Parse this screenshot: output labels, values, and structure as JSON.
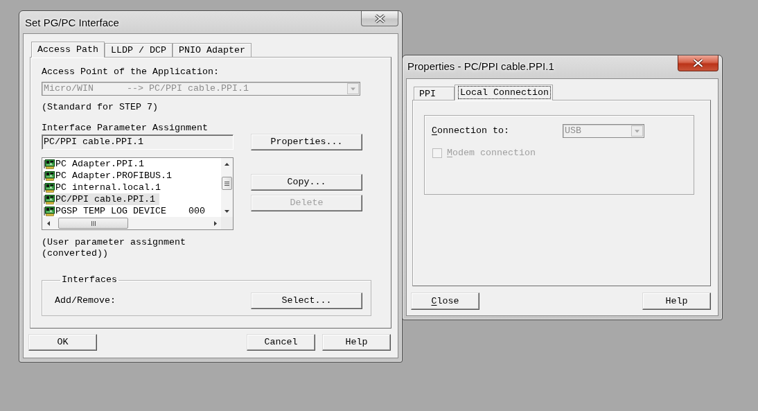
{
  "main_dialog": {
    "title": "Set PG/PC Interface",
    "active": false,
    "tabs": [
      {
        "label": "Access Path",
        "selected": true
      },
      {
        "label": "LLDP / DCP",
        "selected": false
      },
      {
        "label": "PNIO Adapter",
        "selected": false
      }
    ],
    "access_point": {
      "label": "Access Point of the Application:",
      "value": "Micro/WIN      --> PC/PPI cable.PPI.1",
      "disabled": true,
      "note": "(Standard for STEP 7)"
    },
    "parameter_assignment": {
      "label": "Interface Parameter Assignment",
      "value": "PC/PPI cable.PPI.1",
      "read_only": true,
      "items": [
        {
          "label": "PC Adapter.PPI.1",
          "selected": false
        },
        {
          "label": "PC Adapter.PROFIBUS.1",
          "selected": false
        },
        {
          "label": "PC internal.local.1",
          "selected": false
        },
        {
          "label": "PC/PPI cable.PPI.1",
          "selected": true
        },
        {
          "label": "PGSP TEMP LOG DEVICE    000",
          "selected": false
        }
      ],
      "note": "(User parameter assignment (converted))"
    },
    "side_buttons": [
      {
        "label": "Properties...",
        "disabled": false
      },
      {
        "label": "Copy...",
        "disabled": false
      },
      {
        "label": "Delete",
        "disabled": true
      }
    ],
    "interfaces": {
      "title": "Interfaces",
      "label": "Add/Remove:",
      "button": {
        "label": "Select..."
      }
    },
    "buttons": [
      {
        "label": "OK"
      },
      {
        "label": "Cancel"
      },
      {
        "label": "Help"
      }
    ]
  },
  "properties_dialog": {
    "title": "Properties - PC/PPI cable.PPI.1",
    "active": true,
    "tabs": [
      {
        "label": "PPI",
        "selected": false,
        "focused": false
      },
      {
        "label": "Local Connection",
        "selected": true,
        "focused": true
      }
    ],
    "connection": {
      "label": "Connection to:",
      "mnemonic": true,
      "value": "USB",
      "disabled": true
    },
    "modem": {
      "label": "Modem connection",
      "mnemonic": true,
      "checked": false,
      "disabled": true
    },
    "buttons": [
      {
        "label": "Close",
        "mnemonic": true
      },
      {
        "label": "Help",
        "mnemonic": false
      }
    ]
  }
}
